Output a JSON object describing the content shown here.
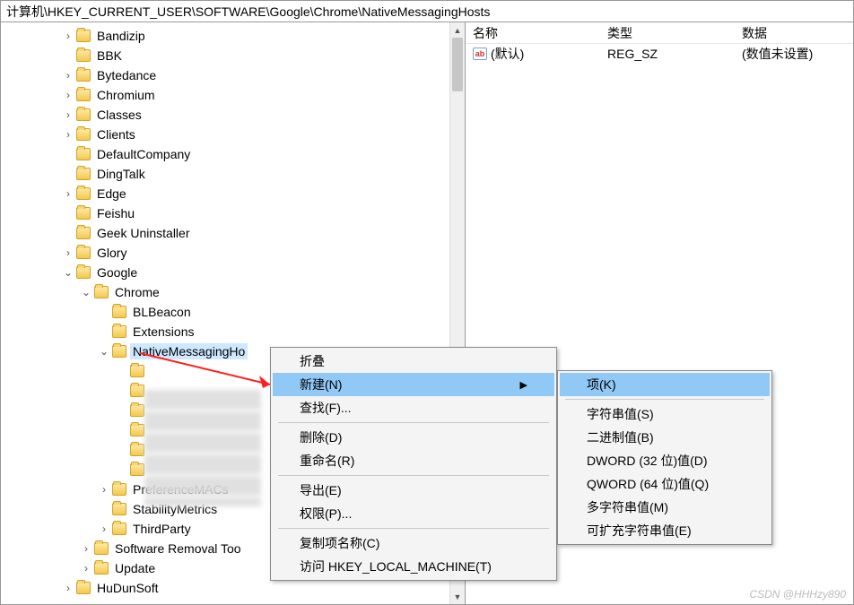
{
  "address": "计算机\\HKEY_CURRENT_USER\\SOFTWARE\\Google\\Chrome\\NativeMessagingHosts",
  "tree": {
    "l1": [
      {
        "label": "Bandizip",
        "exp": ">"
      },
      {
        "label": "BBK",
        "exp": ""
      },
      {
        "label": "Bytedance",
        "exp": ">"
      },
      {
        "label": "Chromium",
        "exp": ">"
      },
      {
        "label": "Classes",
        "exp": ">"
      },
      {
        "label": "Clients",
        "exp": ">"
      },
      {
        "label": "DefaultCompany",
        "exp": ""
      },
      {
        "label": "DingTalk",
        "exp": ""
      },
      {
        "label": "Edge",
        "exp": ">"
      },
      {
        "label": "Feishu",
        "exp": ""
      },
      {
        "label": "Geek Uninstaller",
        "exp": ""
      },
      {
        "label": "Glory",
        "exp": ">"
      }
    ],
    "google": {
      "label": "Google",
      "exp": "v"
    },
    "chrome": {
      "label": "Chrome",
      "exp": "v"
    },
    "chrome_children": [
      {
        "label": "BLBeacon",
        "exp": ""
      },
      {
        "label": "Extensions",
        "exp": ""
      }
    ],
    "nmh": {
      "label": "NativeMessagingHosts",
      "short": "NativeMessagingHo",
      "exp": "v"
    },
    "l1_after": [
      {
        "label": "PreferenceMACs",
        "exp": ">"
      },
      {
        "label": "StabilityMetrics",
        "exp": ""
      },
      {
        "label": "ThirdParty",
        "exp": ">"
      }
    ],
    "l2_after": [
      {
        "label": "Software Removal Tool",
        "short": "Software Removal Too",
        "exp": ">"
      },
      {
        "label": "Update",
        "exp": ">"
      }
    ],
    "l3_after": [
      {
        "label": "HuDunSoft",
        "exp": ">"
      }
    ]
  },
  "list": {
    "cols": {
      "name": "名称",
      "type": "类型",
      "data": "数据"
    },
    "rows": [
      {
        "name": "(默认)",
        "type": "REG_SZ",
        "data": "(数值未设置)"
      }
    ],
    "icon_text": "ab"
  },
  "menu1": {
    "items": [
      {
        "label": "折叠"
      },
      {
        "label": "新建(N)",
        "hl": true,
        "sub": true
      },
      {
        "label": "查找(F)..."
      },
      {
        "sep": true
      },
      {
        "label": "删除(D)"
      },
      {
        "label": "重命名(R)"
      },
      {
        "sep": true
      },
      {
        "label": "导出(E)"
      },
      {
        "label": "权限(P)..."
      },
      {
        "sep": true
      },
      {
        "label": "复制项名称(C)"
      },
      {
        "label": "访问 HKEY_LOCAL_MACHINE(T)"
      }
    ]
  },
  "menu2": {
    "items": [
      {
        "label": "项(K)",
        "hl": true
      },
      {
        "sep": true
      },
      {
        "label": "字符串值(S)"
      },
      {
        "label": "二进制值(B)"
      },
      {
        "label": "DWORD (32 位)值(D)"
      },
      {
        "label": "QWORD (64 位)值(Q)"
      },
      {
        "label": "多字符串值(M)"
      },
      {
        "label": "可扩充字符串值(E)"
      }
    ]
  },
  "watermark": "CSDN @HHHzy890"
}
